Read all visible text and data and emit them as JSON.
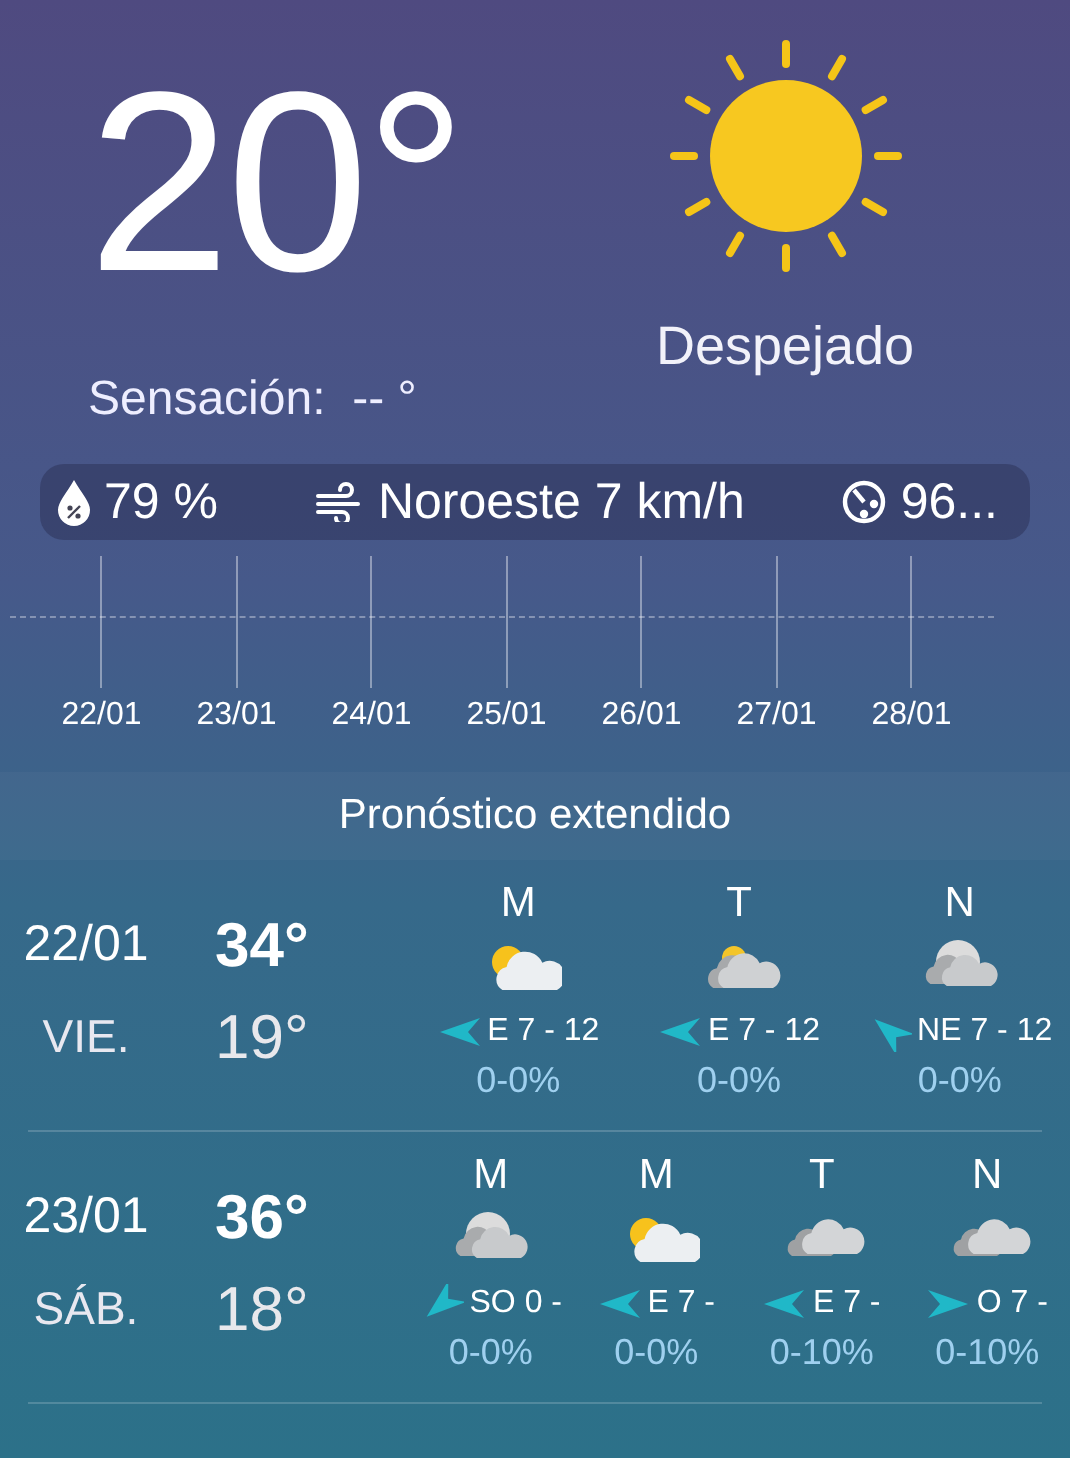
{
  "current": {
    "temperature": "20°",
    "feels_like": "Sensación:  -- °",
    "condition": "Despejado"
  },
  "details": [
    {
      "kind": "humidity",
      "text": "79 %"
    },
    {
      "kind": "wind",
      "text": "Noroeste 7 km/h"
    },
    {
      "kind": "pressure",
      "text": "96..."
    }
  ],
  "timeline": [
    "22/01",
    "23/01",
    "24/01",
    "25/01",
    "26/01",
    "27/01",
    "28/01"
  ],
  "forecast_title": "Pronóstico extendido",
  "days": [
    {
      "date": "22/01",
      "weekday": "VIE.",
      "max": "34°",
      "min": "19°",
      "periods": [
        {
          "label": "M",
          "kind": "suncloud",
          "wind": {
            "kind": "west",
            "text": "E 7 - 12"
          },
          "rain": "0-0%"
        },
        {
          "label": "T",
          "kind": "sungreycloud",
          "wind": {
            "kind": "west",
            "text": "E 7 - 12"
          },
          "rain": "0-0%"
        },
        {
          "label": "N",
          "kind": "mooncloud",
          "wind": {
            "kind": "northwest",
            "text": "NE 7 - 12"
          },
          "rain": "0-0%"
        }
      ]
    },
    {
      "date": "23/01",
      "weekday": "SÁB.",
      "max": "36°",
      "min": "18°",
      "periods": [
        {
          "label": "M",
          "kind": "mooncloud",
          "wind": {
            "kind": "southwest",
            "text": "SO 0 -"
          },
          "rain": "0-0%"
        },
        {
          "label": "M",
          "kind": "suncloud",
          "wind": {
            "kind": "west",
            "text": "E 7 -"
          },
          "rain": "0-0%"
        },
        {
          "label": "T",
          "kind": "clouds",
          "wind": {
            "kind": "west",
            "text": "E 7 -"
          },
          "rain": "0-10%"
        },
        {
          "label": "N",
          "kind": "clouds",
          "wind": {
            "kind": "east",
            "text": "O 7 -"
          },
          "rain": "0-10%"
        }
      ]
    }
  ]
}
